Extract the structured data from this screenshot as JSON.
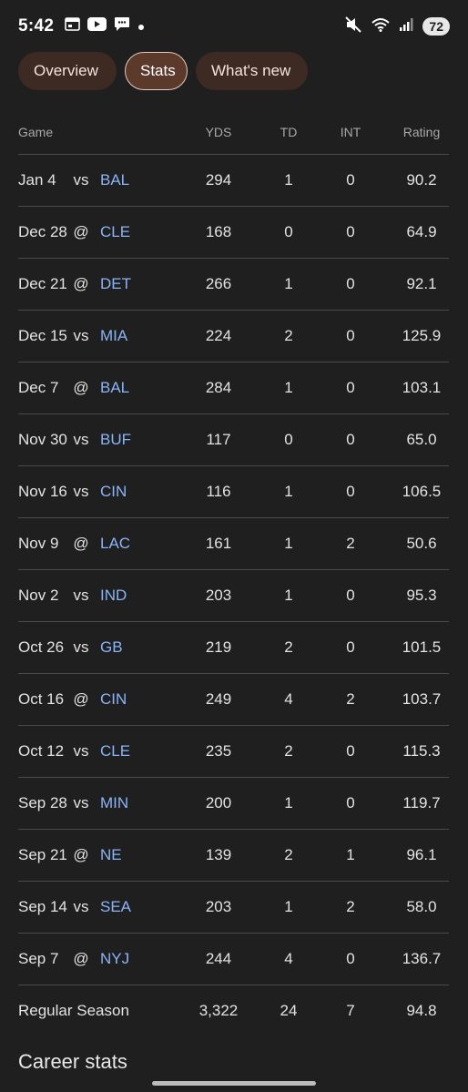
{
  "status_bar": {
    "time": "5:42",
    "battery": "72"
  },
  "tabs": [
    {
      "label": "Overview",
      "active": false
    },
    {
      "label": "Stats",
      "active": true
    },
    {
      "label": "What's new",
      "active": false
    }
  ],
  "table": {
    "headers": {
      "game": "Game",
      "yds": "YDS",
      "td": "TD",
      "int": "INT",
      "rating": "Rating"
    },
    "rows": [
      {
        "date": "Jan 4",
        "ha": "vs",
        "opp": "BAL",
        "yds": "294",
        "td": "1",
        "int": "0",
        "rating": "90.2"
      },
      {
        "date": "Dec 28",
        "ha": "@",
        "opp": "CLE",
        "yds": "168",
        "td": "0",
        "int": "0",
        "rating": "64.9"
      },
      {
        "date": "Dec 21",
        "ha": "@",
        "opp": "DET",
        "yds": "266",
        "td": "1",
        "int": "0",
        "rating": "92.1"
      },
      {
        "date": "Dec 15",
        "ha": "vs",
        "opp": "MIA",
        "yds": "224",
        "td": "2",
        "int": "0",
        "rating": "125.9"
      },
      {
        "date": "Dec 7",
        "ha": "@",
        "opp": "BAL",
        "yds": "284",
        "td": "1",
        "int": "0",
        "rating": "103.1"
      },
      {
        "date": "Nov 30",
        "ha": "vs",
        "opp": "BUF",
        "yds": "117",
        "td": "0",
        "int": "0",
        "rating": "65.0"
      },
      {
        "date": "Nov 16",
        "ha": "vs",
        "opp": "CIN",
        "yds": "116",
        "td": "1",
        "int": "0",
        "rating": "106.5"
      },
      {
        "date": "Nov 9",
        "ha": "@",
        "opp": "LAC",
        "yds": "161",
        "td": "1",
        "int": "2",
        "rating": "50.6"
      },
      {
        "date": "Nov 2",
        "ha": "vs",
        "opp": "IND",
        "yds": "203",
        "td": "1",
        "int": "0",
        "rating": "95.3"
      },
      {
        "date": "Oct 26",
        "ha": "vs",
        "opp": "GB",
        "yds": "219",
        "td": "2",
        "int": "0",
        "rating": "101.5"
      },
      {
        "date": "Oct 16",
        "ha": "@",
        "opp": "CIN",
        "yds": "249",
        "td": "4",
        "int": "2",
        "rating": "103.7"
      },
      {
        "date": "Oct 12",
        "ha": "vs",
        "opp": "CLE",
        "yds": "235",
        "td": "2",
        "int": "0",
        "rating": "115.3"
      },
      {
        "date": "Sep 28",
        "ha": "vs",
        "opp": "MIN",
        "yds": "200",
        "td": "1",
        "int": "0",
        "rating": "119.7"
      },
      {
        "date": "Sep 21",
        "ha": "@",
        "opp": "NE",
        "yds": "139",
        "td": "2",
        "int": "1",
        "rating": "96.1"
      },
      {
        "date": "Sep 14",
        "ha": "vs",
        "opp": "SEA",
        "yds": "203",
        "td": "1",
        "int": "2",
        "rating": "58.0"
      },
      {
        "date": "Sep 7",
        "ha": "@",
        "opp": "NYJ",
        "yds": "244",
        "td": "4",
        "int": "0",
        "rating": "136.7"
      }
    ],
    "season_total": {
      "label": "Regular Season",
      "yds": "3,322",
      "td": "24",
      "int": "7",
      "rating": "94.8"
    }
  },
  "section": {
    "career_title": "Career stats"
  },
  "colors": {
    "background": "#1f1f1f",
    "team_link": "#8ab4f8",
    "chip_bg": "#3d2a22",
    "chip_active_bg": "#5b3a2c"
  }
}
